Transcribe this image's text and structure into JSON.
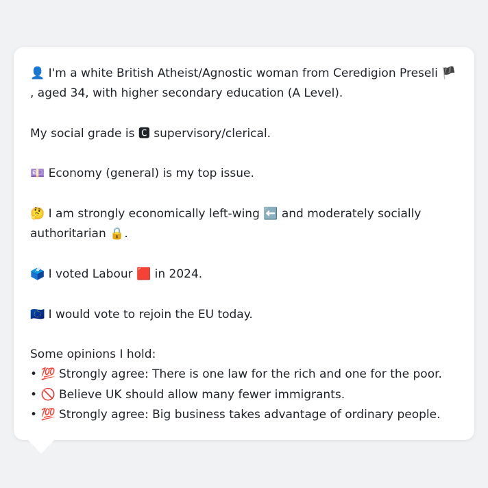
{
  "intro": {
    "icon": "👤",
    "text_before_flag": " I'm a white British Atheist/Agnostic woman from Ceredigion Preseli ",
    "flag": "🏴",
    "text_after_flag": ", aged 34, with higher secondary education (A Level)."
  },
  "social_grade": {
    "prefix": "My social grade is ",
    "badge": "🅲",
    "suffix": " supervisory/clerical."
  },
  "top_issue": {
    "icon": "💷",
    "text": " Economy (general) is my top issue."
  },
  "ideology": {
    "icon": "🤔",
    "text_before_left": " I am strongly economically left-wing ",
    "left_icon": "⬅️",
    "text_middle": " and moderately socially authoritarian ",
    "lock_icon": "🔒",
    "text_end": "."
  },
  "vote": {
    "icon": "🗳️",
    "text_before": " I voted Labour ",
    "party_icon": "🟥",
    "text_after": " in 2024."
  },
  "eu": {
    "icon": "🇪🇺",
    "text": " I would vote to rejoin the EU today."
  },
  "opinions": {
    "heading": "Some opinions I hold:",
    "items": [
      {
        "bullet": "• ",
        "icon": "💯",
        "text": " Strongly agree: There is one law for the rich and one for the poor."
      },
      {
        "bullet": "• ",
        "icon": "🚫",
        "text": " Believe UK should allow many fewer immigrants."
      },
      {
        "bullet": "• ",
        "icon": "💯",
        "text": " Strongly agree: Big business takes advantage of ordinary people."
      }
    ]
  }
}
